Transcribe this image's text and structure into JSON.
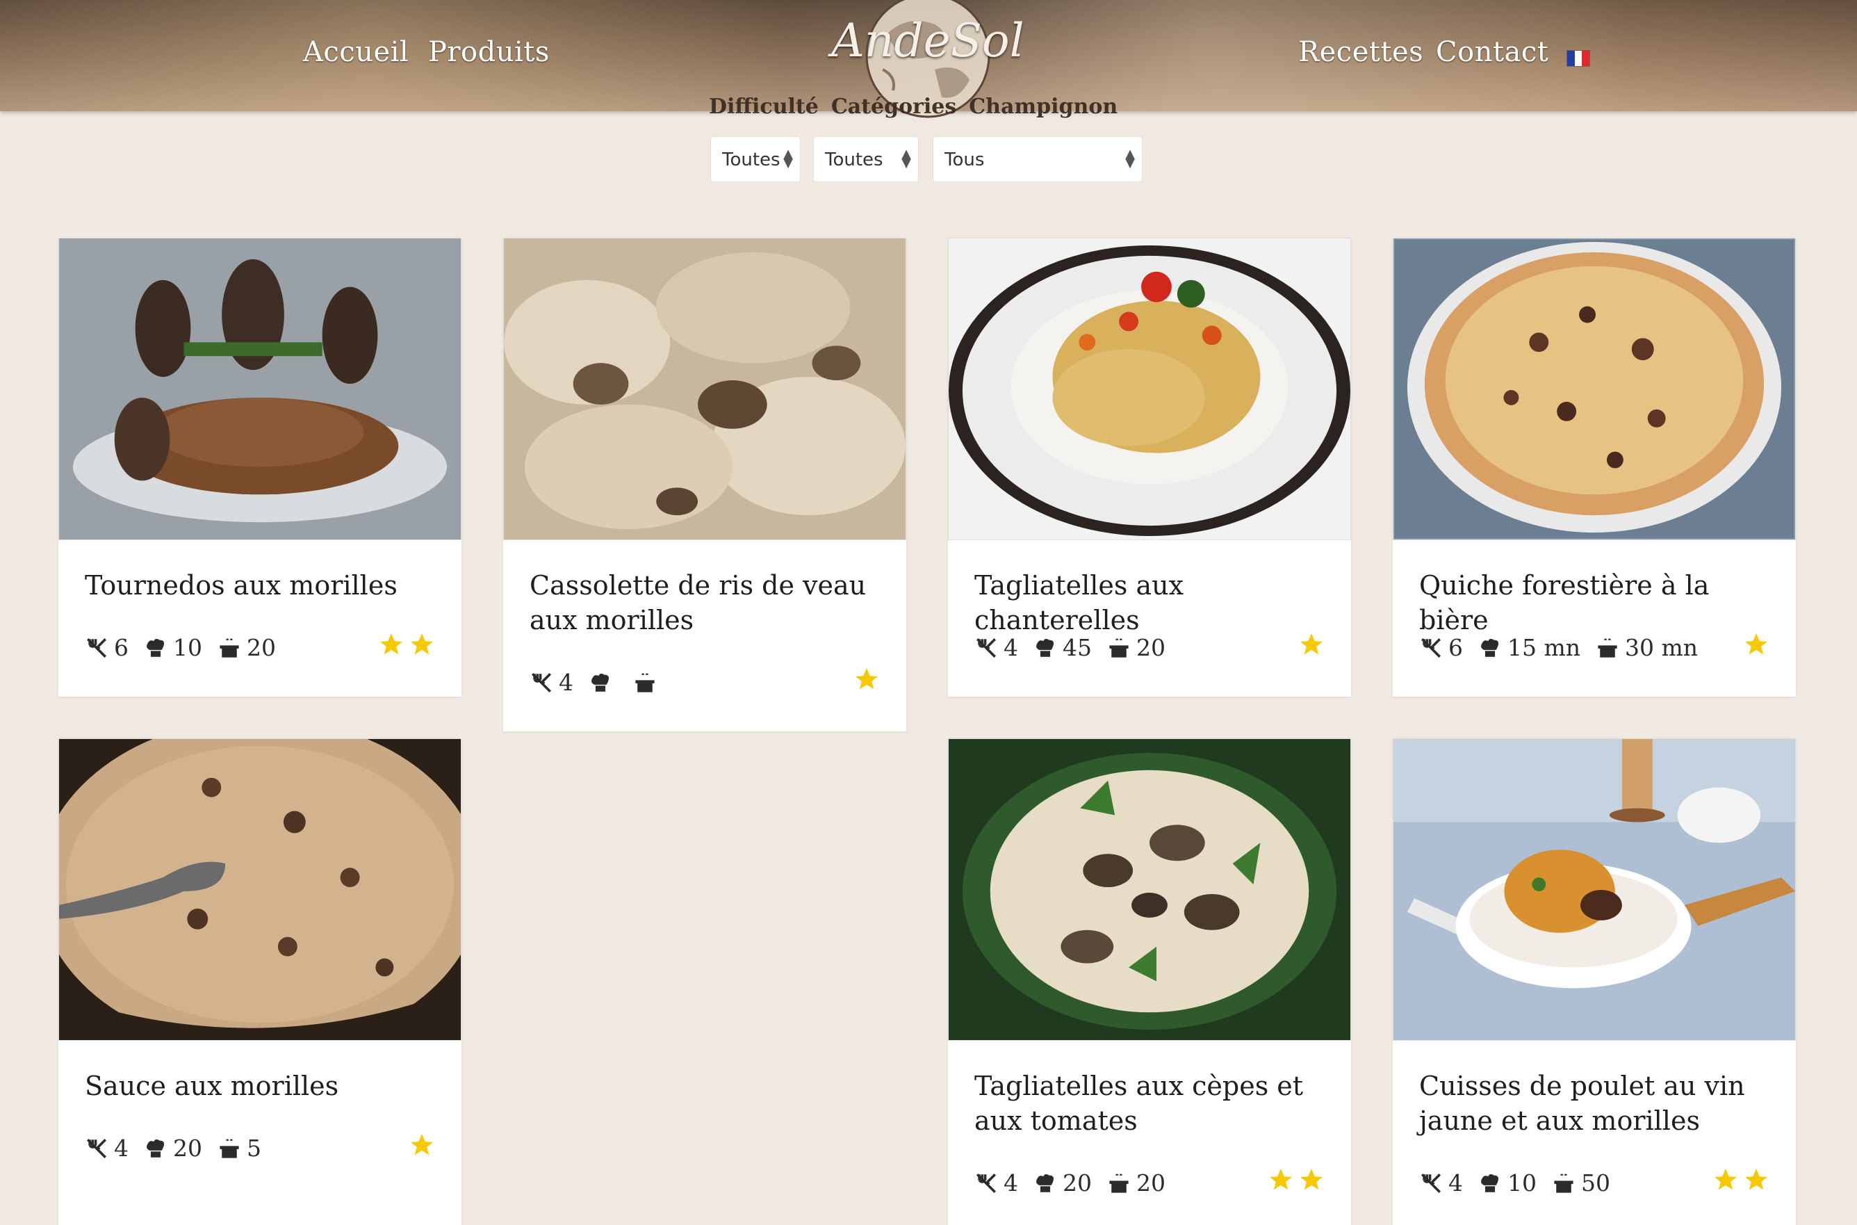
{
  "nav": {
    "home": "Accueil",
    "products": "Produits",
    "recipes": "Recettes",
    "contact": "Contact",
    "logo_text": "AndeSol",
    "language_flag": "french-flag-icon"
  },
  "filters": {
    "labels": [
      "Difficulté",
      "Catégories",
      "Champignon"
    ],
    "difficulty_value": "Toutes",
    "category_value": "Toutes",
    "mushroom_value": "Tous"
  },
  "recipes": [
    {
      "title": "Tournedos aux morilles",
      "servings": "6",
      "prep": "10",
      "cook": "20",
      "difficulty_stars": 2
    },
    {
      "title": "Cassolette de ris de veau aux morilles",
      "servings": "4",
      "prep": "",
      "cook": "",
      "difficulty_stars": 1
    },
    {
      "title": "Tagliatelles aux chanterelles",
      "servings": "4",
      "prep": "45",
      "cook": "20",
      "difficulty_stars": 1
    },
    {
      "title": "Quiche forestière à la bière",
      "servings": "6",
      "prep": "15 mn",
      "cook": "30 mn",
      "difficulty_stars": 1
    },
    {
      "title": "Sauce aux morilles",
      "servings": "4",
      "prep": "20",
      "cook": "5",
      "difficulty_stars": 1
    },
    {
      "title": "Tagliatelles aux cèpes et aux tomates",
      "servings": "4",
      "prep": "20",
      "cook": "20",
      "difficulty_stars": 2
    },
    {
      "title": "Cuisses de poulet au vin jaune et aux morilles",
      "servings": "4",
      "prep": "10",
      "cook": "50",
      "difficulty_stars": 2
    }
  ],
  "colors": {
    "page_bg": "#efe9e1",
    "star": "#f6c800",
    "text": "#1e1e1e",
    "nav_text": "#ffffff"
  }
}
